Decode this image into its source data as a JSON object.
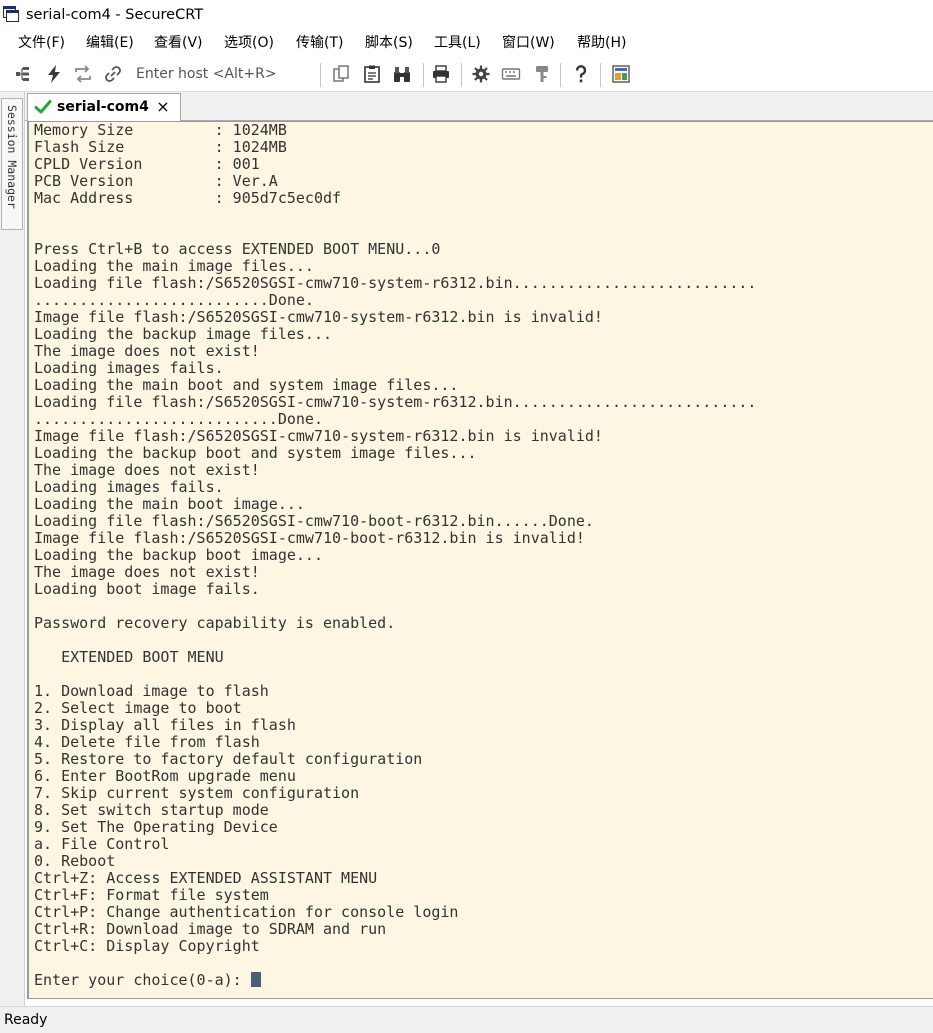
{
  "window": {
    "title": "serial-com4 - SecureCRT"
  },
  "menu": {
    "items": [
      "文件(F)",
      "编辑(E)",
      "查看(V)",
      "选项(O)",
      "传输(T)",
      "脚本(S)",
      "工具(L)",
      "窗口(W)",
      "帮助(H)"
    ]
  },
  "toolbar": {
    "host_placeholder": "Enter host <Alt+R>"
  },
  "side_panel": {
    "label": "Session Manager"
  },
  "tab": {
    "label": "serial-com4",
    "close_glyph": "×"
  },
  "terminal": {
    "lines": [
      "Memory Size         : 1024MB",
      "Flash Size          : 1024MB",
      "CPLD Version        : 001",
      "PCB Version         : Ver.A",
      "Mac Address         : 905d7c5ec0df",
      "",
      "",
      "Press Ctrl+B to access EXTENDED BOOT MENU...0",
      "Loading the main image files...",
      "Loading file flash:/S6520SGSI-cmw710-system-r6312.bin...........................",
      "..........................Done.",
      "Image file flash:/S6520SGSI-cmw710-system-r6312.bin is invalid!",
      "Loading the backup image files...",
      "The image does not exist!",
      "Loading images fails.",
      "Loading the main boot and system image files...",
      "Loading file flash:/S6520SGSI-cmw710-system-r6312.bin...........................",
      "...........................Done.",
      "Image file flash:/S6520SGSI-cmw710-system-r6312.bin is invalid!",
      "Loading the backup boot and system image files...",
      "The image does not exist!",
      "Loading images fails.",
      "Loading the main boot image...",
      "Loading file flash:/S6520SGSI-cmw710-boot-r6312.bin......Done.",
      "Image file flash:/S6520SGSI-cmw710-boot-r6312.bin is invalid!",
      "Loading the backup boot image...",
      "The image does not exist!",
      "Loading boot image fails.",
      "",
      "Password recovery capability is enabled.",
      "",
      "   EXTENDED BOOT MENU",
      "",
      "1. Download image to flash",
      "2. Select image to boot",
      "3. Display all files in flash",
      "4. Delete file from flash",
      "5. Restore to factory default configuration",
      "6. Enter BootRom upgrade menu",
      "7. Skip current system configuration",
      "8. Set switch startup mode",
      "9. Set The Operating Device",
      "a. File Control",
      "0. Reboot",
      "Ctrl+Z: Access EXTENDED ASSISTANT MENU",
      "Ctrl+F: Format file system",
      "Ctrl+P: Change authentication for console login",
      "Ctrl+R: Download image to SDRAM and run",
      "Ctrl+C: Display Copyright",
      ""
    ],
    "prompt": "Enter your choice(0-a): "
  },
  "status": {
    "text": "Ready"
  },
  "icons": {
    "app": "securecrt-app-icon",
    "tab_status": "connected-check-icon",
    "toolbar": [
      "connect-bar-icon",
      "lightning-icon",
      "reconnect-icon",
      "link-icon",
      "copy-icon",
      "paste-icon",
      "find-icon",
      "print-icon",
      "settings-icon",
      "keymap-icon",
      "key-icon",
      "help-icon",
      "script-icon"
    ]
  },
  "colors": {
    "terminal_background": "#fdf6e3",
    "terminal_text": "#333333",
    "cursor": "#4a6077",
    "connected_check": "#22a83a"
  }
}
